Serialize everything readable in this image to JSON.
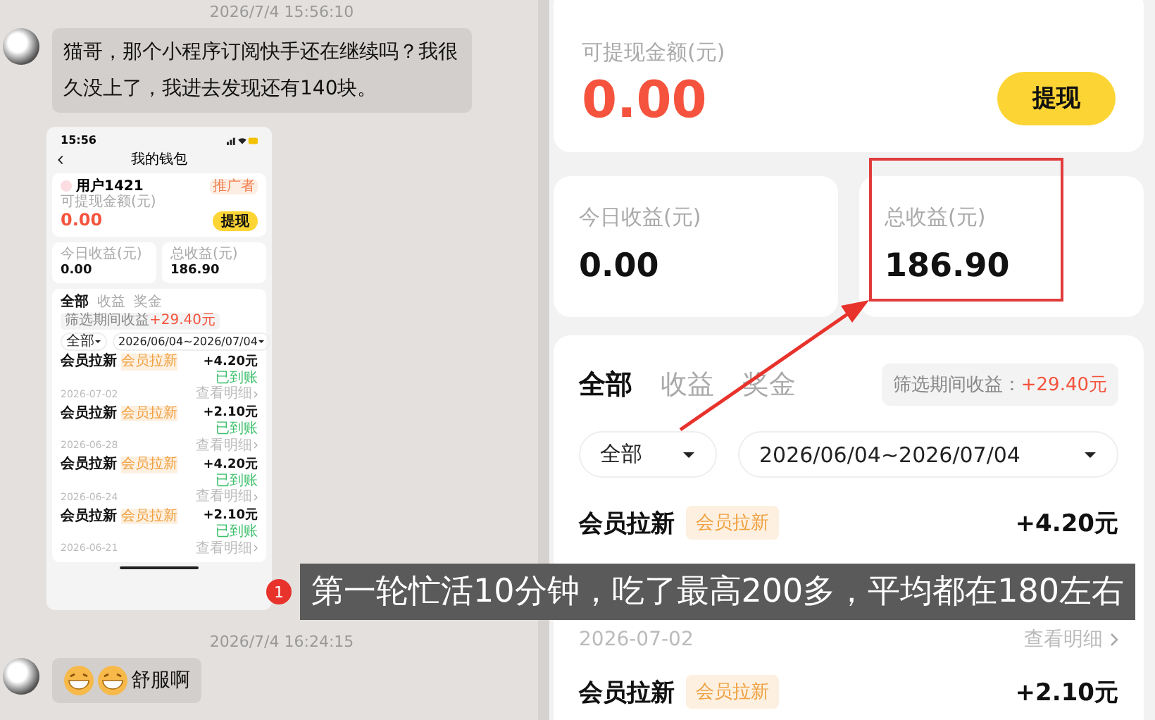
{
  "chat": {
    "messages": [
      {
        "kind": "timestamp",
        "text": "2026/7/4 15:56:10"
      },
      {
        "kind": "text",
        "text": "猫哥，那个小程序订阅快手还在继续吗？我很久没上了，我进去发现还有140块。"
      },
      {
        "kind": "screenshot"
      },
      {
        "kind": "timestamp",
        "text": "2026/7/4 16:24:15"
      },
      {
        "kind": "emoji_text",
        "text": "舒服啊"
      }
    ]
  },
  "thumbnail": {
    "time": "15:56",
    "title": "我的钱包",
    "user": "用户1421",
    "role": "推广者",
    "balance_label": "可提现金额(元)",
    "balance": "0.00",
    "withdraw": "提现",
    "stats": [
      {
        "label": "今日收益(元)",
        "value": "0.00",
        "highlighted": false
      },
      {
        "label": "总收益(元)",
        "value": "186.90",
        "highlighted": false
      }
    ],
    "tabs": [
      {
        "label": "全部",
        "selected": true
      },
      {
        "label": "收益",
        "selected": false
      },
      {
        "label": "奖金",
        "selected": false
      }
    ],
    "period_label": "筛选期间收益",
    "period_value": "+29.40元",
    "filter": "全部",
    "date_range": "2026/06/04~2026/07/04",
    "records": [
      {
        "title": "会员拉新",
        "tag": "会员拉新",
        "amount": "+4.20元",
        "status": "已到账",
        "date": "2026-07-02",
        "link": "查看明细"
      },
      {
        "title": "会员拉新",
        "tag": "会员拉新",
        "amount": "+2.10元",
        "status": "已到账",
        "date": "2026-06-28",
        "link": "查看明细"
      },
      {
        "title": "会员拉新",
        "tag": "会员拉新",
        "amount": "+4.20元",
        "status": "已到账",
        "date": "2026-06-24",
        "link": "查看明细"
      },
      {
        "title": "会员拉新",
        "tag": "会员拉新",
        "amount": "+2.10元",
        "status": "已到账",
        "date": "2026-06-21",
        "link": "查看明细"
      }
    ]
  },
  "wallet": {
    "balance_label": "可提现金额(元)",
    "balance": "0.00",
    "withdraw": "提现",
    "stats": [
      {
        "label": "今日收益(元)",
        "value": "0.00",
        "highlighted": false
      },
      {
        "label": "总收益(元)",
        "value": "186.90",
        "highlighted": true
      }
    ],
    "tabs": [
      {
        "label": "全部",
        "selected": true
      },
      {
        "label": "收益",
        "selected": false
      },
      {
        "label": "奖金",
        "selected": false
      }
    ],
    "period_label": "筛选期间收益：",
    "period_value": "+29.40元",
    "filter": "全部",
    "date_range": "2026/06/04~2026/07/04",
    "records": [
      {
        "title": "会员拉新",
        "tag": "会员拉新",
        "amount": "+4.20元",
        "date": "2026-07-02",
        "link": "查看明细"
      },
      {
        "title": "会员拉新",
        "tag": "会员拉新",
        "amount": "+2.10元"
      }
    ]
  },
  "caption": {
    "badge": "1",
    "text": "第一轮忙活10分钟，吃了最高200多，平均都在180左右"
  }
}
